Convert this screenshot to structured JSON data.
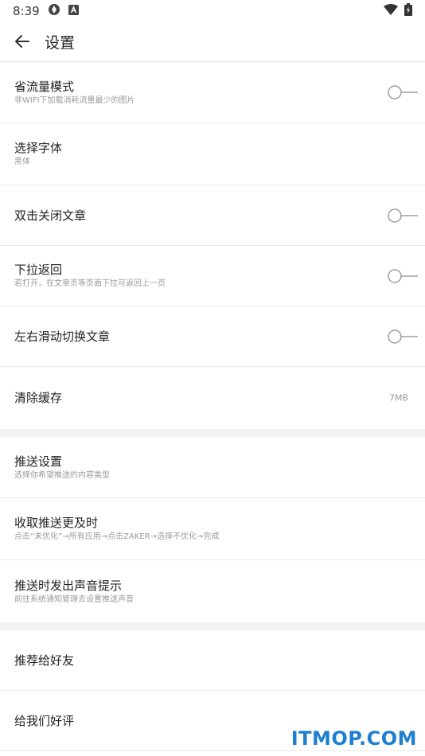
{
  "status_bar": {
    "time": "8:39"
  },
  "header": {
    "title": "设置"
  },
  "settings": [
    {
      "label": "省流量模式",
      "sub": "非WIFI下加载消耗流量最少的图片"
    },
    {
      "label": "选择字体",
      "sub": "黑体"
    },
    {
      "label": "双击关闭文章"
    },
    {
      "label": "下拉返回",
      "sub": "若打开，在文章页等页面下拉可返回上一页"
    },
    {
      "label": "左右滑动切换文章"
    },
    {
      "label": "清除缓存",
      "value": "7MB"
    },
    {
      "label": "推送设置",
      "sub": "选择你希望推送的内容类型"
    },
    {
      "label": "收取推送更及时",
      "sub": "点击“未优化”→所有应用→点击ZAKER→选择不优化→完成"
    },
    {
      "label": "推送时发出声音提示",
      "sub": "前往系统通知管理去设置推送声音"
    },
    {
      "label": "推荐给好友"
    },
    {
      "label": "给我们好评"
    }
  ],
  "toggles": {
    "save_data": false,
    "double_tap_close": false,
    "pull_back": false,
    "swipe_switch": false
  },
  "watermark": "ITMOP.COM",
  "colors": {
    "watermark": "#1e7fd0",
    "toggle": "#9e9e9e"
  }
}
